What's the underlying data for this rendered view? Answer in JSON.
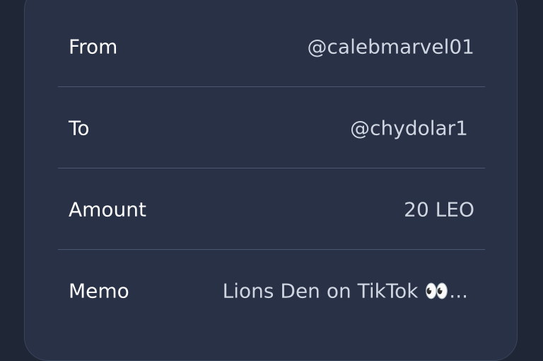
{
  "details": {
    "rows": [
      {
        "label": "From",
        "value": "@calebmarvel01"
      },
      {
        "label": "To",
        "value": "@chydolar1"
      },
      {
        "label": "Amount",
        "value": "20 LEO"
      },
      {
        "label": "Memo",
        "value": "Lions Den on TikTok 👀..."
      }
    ]
  }
}
